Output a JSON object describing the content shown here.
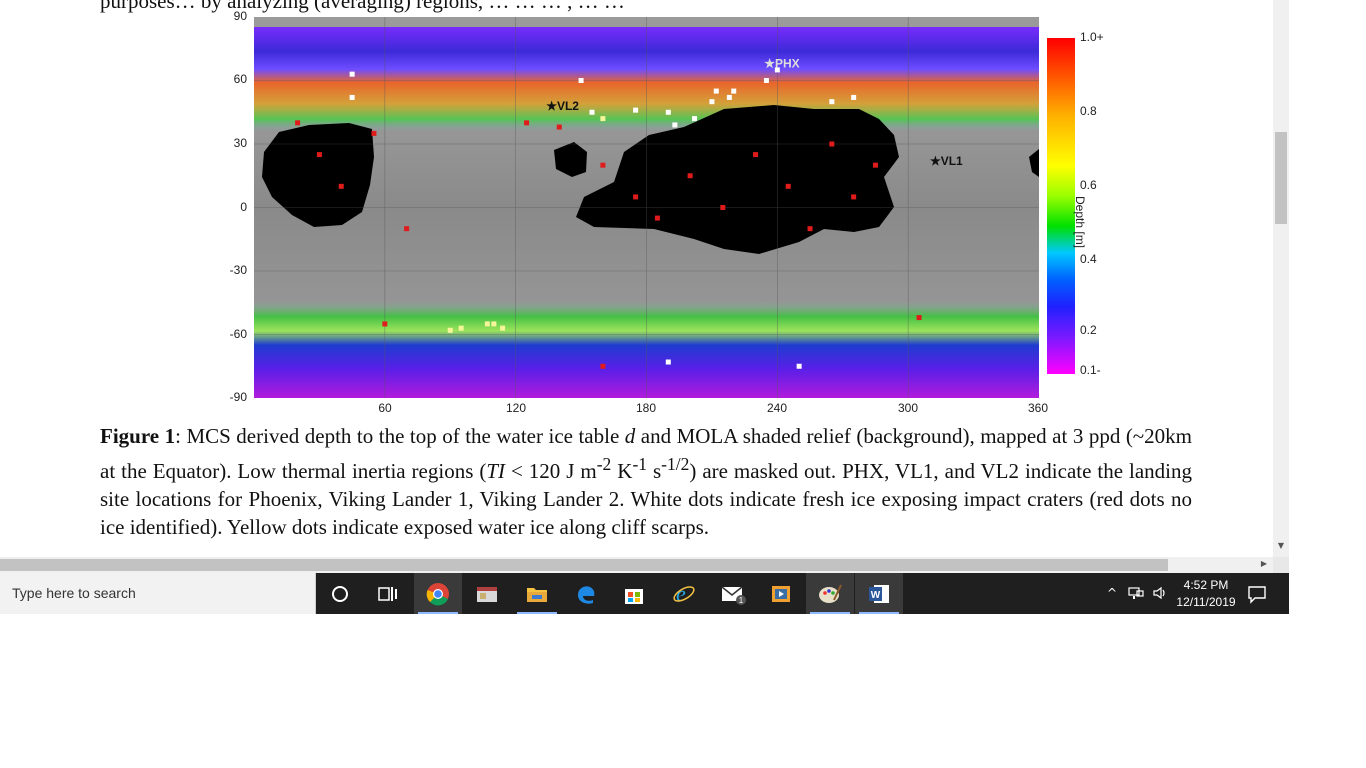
{
  "document": {
    "top_clipped_text": "purposes… by analyzing (averaging) regions, … … … , … …",
    "caption": {
      "label": "Figure 1",
      "text_a": ": MCS derived depth to the top of the water ice table ",
      "var_d": "d",
      "text_b": " and MOLA shaded relief (background), mapped at 3 ppd (~20km at the Equator). Low thermal inertia regions (",
      "var_ti": "TI",
      "text_c": " < 120 J m",
      "sup1": "-2",
      "text_d": " K",
      "sup2": "-1",
      "text_e": " s",
      "sup3": "-1/2",
      "text_f": ") are masked out. PHX, VL1, and VL2 indicate the landing site locations for Phoenix, Viking Lander 1, Viking Lander 2. White dots indicate fresh ice exposing impact craters (red dots no ice identified). Yellow dots indicate exposed water ice along cliff scarps."
    }
  },
  "chart_data": {
    "type": "heatmap",
    "title": "",
    "xlabel": "",
    "ylabel": "",
    "x_ticks": [
      "60",
      "120",
      "180",
      "240",
      "300",
      "360"
    ],
    "y_ticks": [
      "90",
      "60",
      "30",
      "0",
      "-30",
      "-60",
      "-90"
    ],
    "xlim": [
      0,
      360
    ],
    "ylim": [
      -90,
      90
    ],
    "colorbar": {
      "label": "Depth [m]",
      "ticks": [
        "1.0+",
        "0.8",
        "0.6",
        "0.4",
        "0.2",
        "0.1-"
      ],
      "range": [
        0.1,
        1.0
      ]
    },
    "landing_sites": [
      {
        "name": "PHX",
        "lon": 234,
        "lat": 68
      },
      {
        "name": "VL2",
        "lon": 134,
        "lat": 48
      },
      {
        "name": "VL1",
        "lon": 310,
        "lat": 22
      }
    ],
    "white_dots": [
      [
        45,
        63
      ],
      [
        45,
        52
      ],
      [
        150,
        60
      ],
      [
        155,
        45
      ],
      [
        175,
        46
      ],
      [
        190,
        45
      ],
      [
        193,
        39
      ],
      [
        202,
        42
      ],
      [
        210,
        50
      ],
      [
        212,
        55
      ],
      [
        218,
        52
      ],
      [
        220,
        55
      ],
      [
        235,
        60
      ],
      [
        240,
        65
      ],
      [
        265,
        50
      ],
      [
        275,
        52
      ],
      [
        190,
        -73
      ],
      [
        250,
        -75
      ]
    ],
    "yellow_dots": [
      [
        90,
        -58
      ],
      [
        95,
        -57
      ],
      [
        107,
        -55
      ],
      [
        110,
        -55
      ],
      [
        114,
        -57
      ],
      [
        160,
        42
      ]
    ],
    "red_dots_sample": [
      [
        20,
        40
      ],
      [
        30,
        25
      ],
      [
        40,
        10
      ],
      [
        55,
        35
      ],
      [
        70,
        -10
      ],
      [
        125,
        40
      ],
      [
        140,
        38
      ],
      [
        160,
        20
      ],
      [
        175,
        5
      ],
      [
        185,
        -5
      ],
      [
        200,
        15
      ],
      [
        215,
        0
      ],
      [
        230,
        25
      ],
      [
        245,
        10
      ],
      [
        255,
        -10
      ],
      [
        265,
        30
      ],
      [
        275,
        5
      ],
      [
        285,
        20
      ],
      [
        60,
        -55
      ],
      [
        160,
        -75
      ],
      [
        305,
        -52
      ]
    ],
    "colors": {
      "mask": "#000000",
      "background": "#8e8e8e",
      "dots_red": "#e01b1b",
      "dots_white": "#ffffff",
      "dots_yellow": "#f5f59a"
    }
  },
  "taskbar": {
    "search_placeholder": "Type here to search",
    "apps": [
      "cortana-icon",
      "task-view-icon",
      "chrome-icon",
      "app-icon",
      "file-explorer-icon",
      "edge-icon",
      "store-icon",
      "ie-icon",
      "mail-icon",
      "video-icon",
      "paint-icon",
      "word-icon"
    ],
    "mail_badge": "1",
    "time": "4:52 PM",
    "date": "12/11/2019"
  }
}
